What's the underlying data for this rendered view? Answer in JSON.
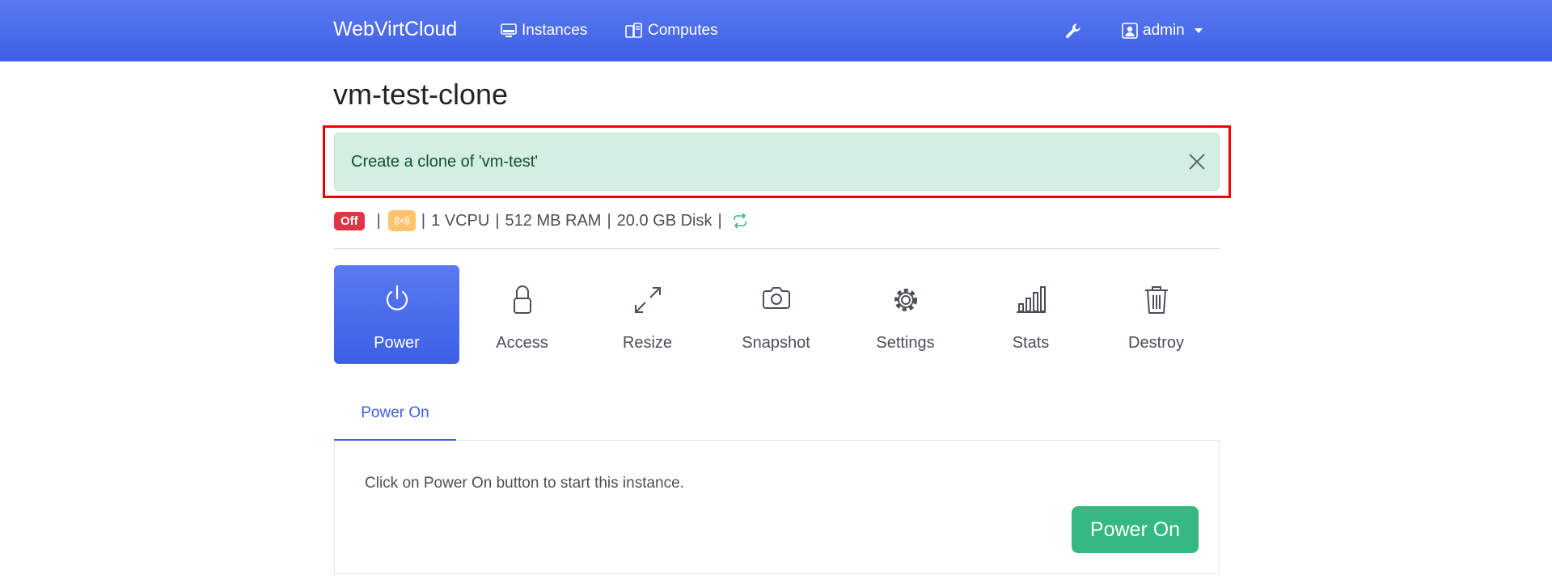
{
  "navbar": {
    "brand": "WebVirtCloud",
    "instances_label": "Instances",
    "computes_label": "Computes",
    "user_label": "admin",
    "icons": {
      "instances": "monitor-icon",
      "computes": "server-icon",
      "tools": "wrench-icon",
      "user": "user-icon"
    }
  },
  "page": {
    "title": "vm-test-clone"
  },
  "alert": {
    "message": "Create a clone of 'vm-test'",
    "close_icon": "close-icon"
  },
  "status": {
    "power_state": "Off",
    "vcpu": "1 VCPU",
    "ram": "512 MB RAM",
    "disk": "20.0 GB Disk",
    "separator": "|",
    "icons": {
      "console": "broadcast-icon",
      "refresh": "refresh-icon"
    }
  },
  "actions": [
    {
      "label": "Power",
      "icon": "power-icon",
      "active": true
    },
    {
      "label": "Access",
      "icon": "lock-icon",
      "active": false
    },
    {
      "label": "Resize",
      "icon": "arrows-expand-icon",
      "active": false
    },
    {
      "label": "Snapshot",
      "icon": "camera-icon",
      "active": false
    },
    {
      "label": "Settings",
      "icon": "gear-icon",
      "active": false
    },
    {
      "label": "Stats",
      "icon": "bar-chart-icon",
      "active": false
    },
    {
      "label": "Destroy",
      "icon": "trash-icon",
      "active": false
    }
  ],
  "tabs": [
    {
      "label": "Power On",
      "active": true
    }
  ],
  "power_panel": {
    "description": "Click on Power On button to start this instance.",
    "button_label": "Power On"
  },
  "colors": {
    "primary": "#3d5fe6",
    "success": "#35b882",
    "danger": "#dc3545",
    "warning": "#ffc46b",
    "alert_bg": "#d4efe2",
    "alert_text": "#0f5132",
    "highlight": "#ee0000"
  }
}
